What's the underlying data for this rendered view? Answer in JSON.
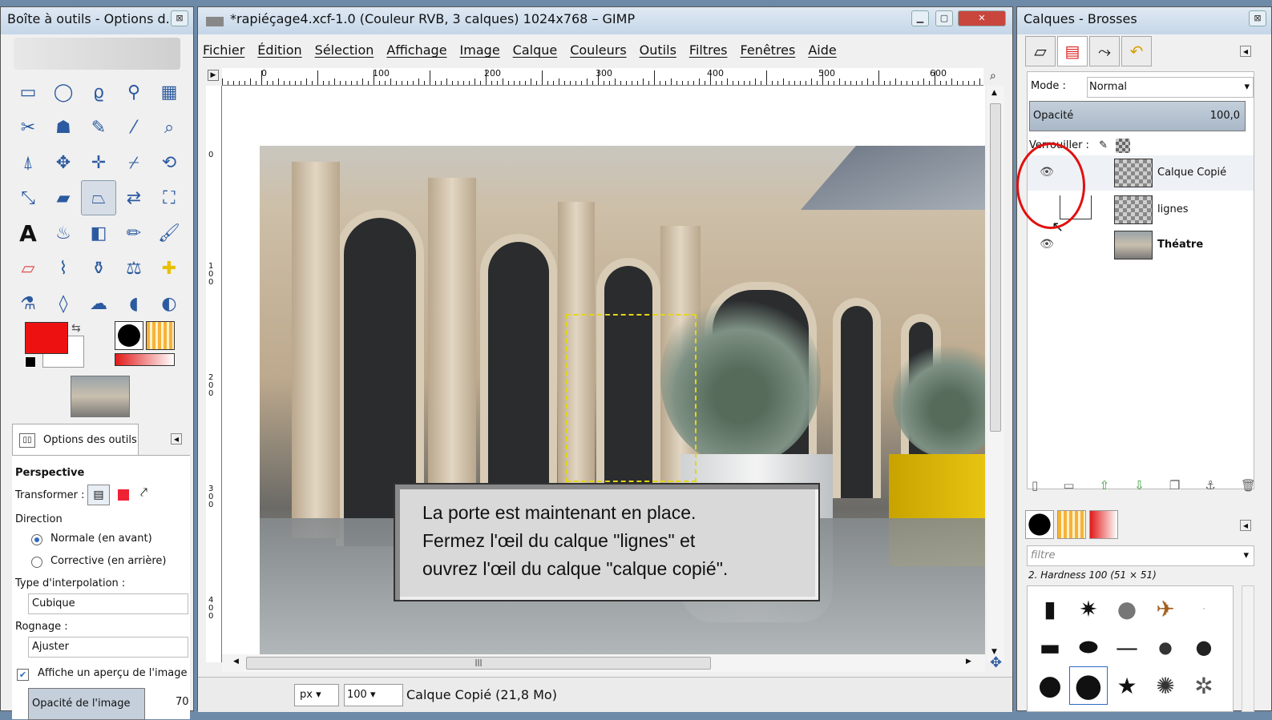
{
  "toolbox": {
    "title": "Boîte à outils - Options d...",
    "close_icon": "close-icon",
    "tools": [
      {
        "name": "rect-select-icon",
        "glyph": "▭"
      },
      {
        "name": "ellipse-select-icon",
        "glyph": "◯"
      },
      {
        "name": "free-select-icon",
        "glyph": "ϱ"
      },
      {
        "name": "fuzzy-select-icon",
        "glyph": "⚲"
      },
      {
        "name": "color-select-icon",
        "glyph": "▦"
      },
      {
        "name": "scissors-icon",
        "glyph": "✂"
      },
      {
        "name": "foreground-select-icon",
        "glyph": "☗"
      },
      {
        "name": "paths-icon",
        "glyph": "✎"
      },
      {
        "name": "color-picker-icon",
        "glyph": "⁄"
      },
      {
        "name": "zoom-icon",
        "glyph": "⌕"
      },
      {
        "name": "measure-icon",
        "glyph": "⍋"
      },
      {
        "name": "move-icon",
        "glyph": "✥"
      },
      {
        "name": "align-icon",
        "glyph": "✛"
      },
      {
        "name": "crop-icon",
        "glyph": "⌿"
      },
      {
        "name": "rotate-icon",
        "glyph": "⟲"
      },
      {
        "name": "scale-icon",
        "glyph": "⤡"
      },
      {
        "name": "shear-icon",
        "glyph": "▰"
      },
      {
        "name": "perspective-icon",
        "glyph": "⏢"
      },
      {
        "name": "flip-icon",
        "glyph": "⇄"
      },
      {
        "name": "cage-icon",
        "glyph": "⛶"
      },
      {
        "name": "text-icon",
        "glyph": "A"
      },
      {
        "name": "bucket-fill-icon",
        "glyph": "♨"
      },
      {
        "name": "blend-icon",
        "glyph": "◧"
      },
      {
        "name": "pencil-icon",
        "glyph": "✏"
      },
      {
        "name": "paintbrush-icon",
        "glyph": "🖌"
      },
      {
        "name": "eraser-icon",
        "glyph": "▱"
      },
      {
        "name": "airbrush-icon",
        "glyph": "⌇"
      },
      {
        "name": "ink-icon",
        "glyph": "⚱"
      },
      {
        "name": "clone-icon",
        "glyph": "⚖"
      },
      {
        "name": "heal-icon",
        "glyph": "✚"
      },
      {
        "name": "perspective-clone-icon",
        "glyph": "⚗"
      },
      {
        "name": "blur-icon",
        "glyph": "◊"
      },
      {
        "name": "smudge-icon",
        "glyph": "☁"
      },
      {
        "name": "dodge-burn-icon",
        "glyph": "◖"
      },
      {
        "name": "desaturate-icon",
        "glyph": "◐"
      }
    ],
    "tab_label": "Options des outils",
    "tool_title": "Perspective",
    "transform_label": "Transformer :",
    "direction_label": "Direction",
    "direction_normal": "Normale (en avant)",
    "direction_corrective": "Corrective (en arrière)",
    "interpolation_label": "Type d'interpolation :",
    "interpolation_value": "Cubique",
    "clipping_label": "Rognage :",
    "clipping_value": "Ajuster",
    "preview_checkbox": "Affiche un aperçu de l'image",
    "image_opacity_label": "Opacité de l'image",
    "image_opacity_value": "70",
    "colors": {
      "foreground": "#ee1111",
      "background": "#ffffff"
    }
  },
  "image_window": {
    "title": "*rapiéçage4.xcf-1.0 (Couleur RVB, 3 calques) 1024x768 – GIMP",
    "menu": [
      "Fichier",
      "Édition",
      "Sélection",
      "Affichage",
      "Image",
      "Calque",
      "Couleurs",
      "Outils",
      "Filtres",
      "Fenêtres",
      "Aide"
    ],
    "ruler_h": [
      "0",
      "100",
      "200",
      "300",
      "400",
      "500",
      "600"
    ],
    "ruler_v": [
      "0",
      "100",
      "200",
      "300",
      "400"
    ],
    "callout_lines": [
      "La porte est maintenant en place.",
      "Fermez l'œil du calque \"lignes\" et",
      "ouvrez l'œil  du calque \"calque copié\"."
    ],
    "unit": "px",
    "zoom": "100",
    "status": "Calque Copié (21,8 Mo)"
  },
  "dock": {
    "title": "Calques - Brosses",
    "mode_label": "Mode :",
    "mode_value": "Normal",
    "opacity_label": "Opacité",
    "opacity_value": "100,0",
    "lock_label": "Verrouiller :",
    "layers": [
      {
        "name": "Calque Copié",
        "visible": true,
        "selected": true
      },
      {
        "name": "lignes",
        "visible": false,
        "selected": false
      },
      {
        "name": "Théatre",
        "visible": true,
        "selected": false
      }
    ],
    "filter_placeholder": "filtre",
    "brush_name": "2. Hardness 100 (51 × 51)"
  }
}
